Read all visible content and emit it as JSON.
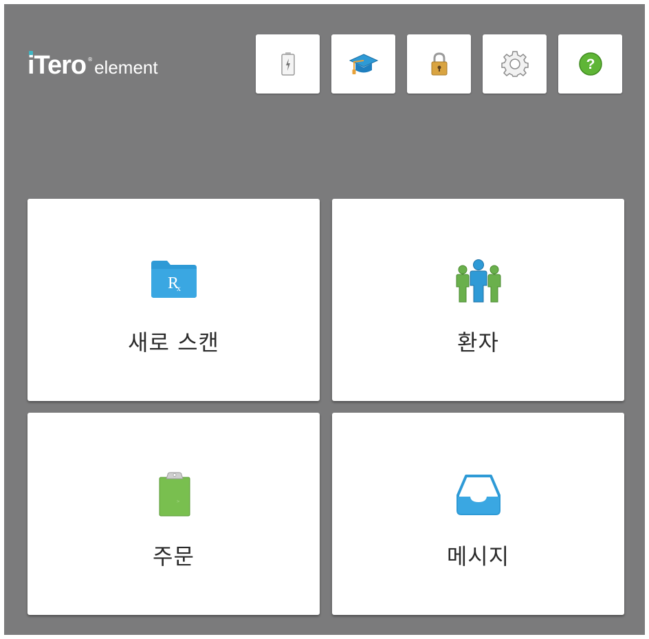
{
  "logo": {
    "main": "iTero",
    "registered": "®",
    "sub": "element"
  },
  "toolbar": {
    "buttons": [
      {
        "name": "battery",
        "icon": "battery-icon"
      },
      {
        "name": "learning-center",
        "icon": "graduation-cap-icon"
      },
      {
        "name": "lock",
        "icon": "padlock-icon"
      },
      {
        "name": "settings",
        "icon": "gear-icon"
      },
      {
        "name": "help",
        "icon": "question-mark-icon",
        "glyph": "?"
      }
    ]
  },
  "tiles": {
    "new_scan": {
      "label": "새로 스캔",
      "icon": "rx-folder-icon",
      "icon_text": "R",
      "icon_sub": "x"
    },
    "patients": {
      "label": "환자",
      "icon": "people-icon"
    },
    "orders": {
      "label": "주문",
      "icon": "clipboard-icon"
    },
    "messages": {
      "label": "메시지",
      "icon": "inbox-tray-icon"
    }
  },
  "colors": {
    "background": "#7b7b7c",
    "tile": "#ffffff",
    "accent_blue": "#2e9ad6",
    "accent_green": "#6ab04c",
    "logo_dot": "#41b6c4"
  }
}
